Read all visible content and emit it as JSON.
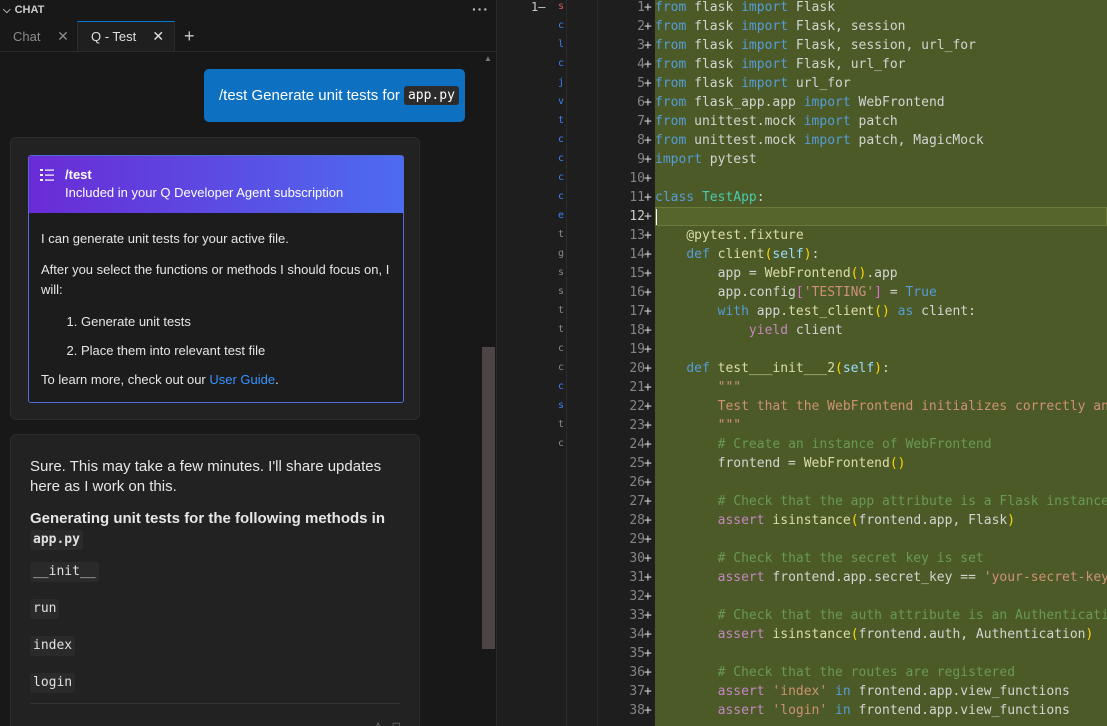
{
  "chat": {
    "header_title": "CHAT",
    "more_label": "···",
    "tabs": [
      {
        "label": "Chat",
        "close": "✕"
      },
      {
        "label": "Q - Test",
        "close": "✕"
      }
    ],
    "add_tab": "+",
    "user_message": {
      "text": "/test Generate unit tests for",
      "file": "app.py"
    },
    "test_card": {
      "title": "/test",
      "subtitle": "Included in your Q Developer Agent subscription",
      "p1": "I can generate unit tests for your active file.",
      "p2": "After you select the functions or methods I should focus on, I will:",
      "steps": [
        "Generate unit tests",
        "Place them into relevant test file"
      ],
      "p3_prefix": "To learn more, check out our ",
      "p3_link": "User Guide",
      "p3_suffix": "."
    },
    "response": {
      "text": "Sure. This may take a few minutes. I'll share updates here as I work on this.",
      "heading": "Generating unit tests for the following methods in",
      "file": "app.py",
      "methods": [
        "__init__",
        "run",
        "index",
        "login"
      ]
    }
  },
  "original_pane": {
    "line_number": "1",
    "line_mark": "—"
  },
  "editor": {
    "lines": [
      {
        "n": "1",
        "code": "from flask import Flask"
      },
      {
        "n": "2",
        "code": "from flask import Flask, session"
      },
      {
        "n": "3",
        "code": "from flask import Flask, session, url_for"
      },
      {
        "n": "4",
        "code": "from flask import Flask, url_for"
      },
      {
        "n": "5",
        "code": "from flask import url_for"
      },
      {
        "n": "6",
        "code": "from flask_app.app import WebFrontend"
      },
      {
        "n": "7",
        "code": "from unittest.mock import patch"
      },
      {
        "n": "8",
        "code": "from unittest.mock import patch, MagicMock"
      },
      {
        "n": "9",
        "code": "import pytest"
      },
      {
        "n": "10",
        "code": ""
      },
      {
        "n": "11",
        "code": "class TestApp:"
      },
      {
        "n": "12",
        "code": ""
      },
      {
        "n": "13",
        "code": "    @pytest.fixture"
      },
      {
        "n": "14",
        "code": "    def client(self):"
      },
      {
        "n": "15",
        "code": "        app = WebFrontend().app"
      },
      {
        "n": "16",
        "code": "        app.config['TESTING'] = True"
      },
      {
        "n": "17",
        "code": "        with app.test_client() as client:"
      },
      {
        "n": "18",
        "code": "            yield client"
      },
      {
        "n": "19",
        "code": ""
      },
      {
        "n": "20",
        "code": "    def test___init___2(self):"
      },
      {
        "n": "21",
        "code": "        \"\"\""
      },
      {
        "n": "22",
        "code": "        Test that the WebFrontend initializes correctly and"
      },
      {
        "n": "23",
        "code": "        \"\"\""
      },
      {
        "n": "24",
        "code": "        # Create an instance of WebFrontend"
      },
      {
        "n": "25",
        "code": "        frontend = WebFrontend()"
      },
      {
        "n": "26",
        "code": ""
      },
      {
        "n": "27",
        "code": "        # Check that the app attribute is a Flask instance"
      },
      {
        "n": "28",
        "code": "        assert isinstance(frontend.app, Flask)"
      },
      {
        "n": "29",
        "code": ""
      },
      {
        "n": "30",
        "code": "        # Check that the secret key is set"
      },
      {
        "n": "31",
        "code": "        assert frontend.app.secret_key == 'your-secret-key'"
      },
      {
        "n": "32",
        "code": ""
      },
      {
        "n": "33",
        "code": "        # Check that the auth attribute is an Authenticatio"
      },
      {
        "n": "34",
        "code": "        assert isinstance(frontend.auth, Authentication)"
      },
      {
        "n": "35",
        "code": ""
      },
      {
        "n": "36",
        "code": "        # Check that the routes are registered"
      },
      {
        "n": "37",
        "code": "        assert 'index' in frontend.app.view_functions"
      },
      {
        "n": "38",
        "code": "        assert 'login' in frontend.app.view_functions"
      }
    ],
    "plus_marker": "+",
    "current_line": "12"
  },
  "colors": {
    "accent": "#0e70c0",
    "added_bg": "#4b5a26",
    "link": "#3794ff"
  }
}
